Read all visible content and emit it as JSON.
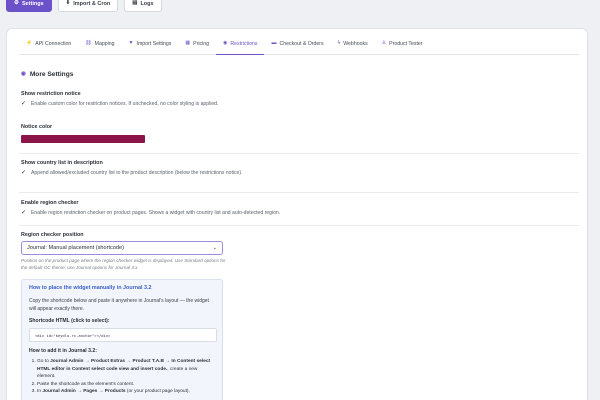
{
  "top_nav": [
    {
      "label": "Settings",
      "icon": "gear-icon",
      "glyph": "⚙",
      "active": true
    },
    {
      "label": "Import & Cron",
      "icon": "import-icon",
      "glyph": "⬇",
      "active": false
    },
    {
      "label": "Logs",
      "icon": "logs-icon",
      "glyph": "▤",
      "active": false
    }
  ],
  "tabs": [
    {
      "label": "API Connection",
      "icon": "plug-icon",
      "glyph": "⚡",
      "active": false
    },
    {
      "label": "Mapping",
      "icon": "mapping-icon",
      "glyph": "⛓",
      "active": false
    },
    {
      "label": "Import Settings",
      "icon": "filter-icon",
      "glyph": "▼",
      "active": false
    },
    {
      "label": "Pricing",
      "icon": "pricing-icon",
      "glyph": "▦",
      "active": false
    },
    {
      "label": "Restrictions",
      "icon": "eye-icon",
      "glyph": "◉",
      "active": true
    },
    {
      "label": "Checkout & Orders",
      "icon": "cart-icon",
      "glyph": "▬",
      "active": false
    },
    {
      "label": "Webhooks",
      "icon": "webhook-icon",
      "glyph": "ϟ",
      "active": false
    },
    {
      "label": "Product Tester",
      "icon": "flask-icon",
      "glyph": "♙",
      "active": false
    }
  ],
  "section": {
    "title": "More Settings",
    "icon": "eye-icon",
    "glyph": "◉"
  },
  "fields": {
    "show_notice": {
      "label": "Show restriction notice",
      "checkbox": "Enable custom color for restriction notices. If unchecked, no color styling is applied.",
      "checked": true
    },
    "notice_color": {
      "label": "Notice color",
      "value": "#8b1449"
    },
    "country_list": {
      "label": "Show country list in description",
      "checkbox": "Append allowed/excluded country list to the product description (below the restrictions notice).",
      "checked": true
    },
    "region_checker": {
      "label": "Enable region checker",
      "checkbox": "Enable region restriction checker on product pages. Shows a widget with country list and auto-detected region.",
      "checked": true
    },
    "region_position": {
      "label": "Region checker position",
      "selected": "Journal: Manual placement (shortcode)",
      "help": "Position on the product page where the region checker widget is displayed. Use Standard options for the default OC theme; use Journal options for Journal 3.x."
    }
  },
  "infobox": {
    "title": "How to place the widget manually in Journal 3.2",
    "intro": "Copy the shortcode below and paste it anywhere in Journal's layout — the widget will appear exactly there.",
    "shortcode_label": "Shortcode HTML (click to select):",
    "shortcode": "<div id=\"keydlo-rc-anchor\"></div>",
    "howto_label": "How to add it in Journal 3.2:",
    "steps": [
      {
        "pre": "Go to ",
        "bold": "Journal Admin → Product Extras → Product T.A.B → In Content select HTML editor in Content select code view and insert code.",
        "post": ", create a new element."
      },
      {
        "pre": "Paste the shortcode as the element's content.",
        "bold": "",
        "post": ""
      },
      {
        "pre": "In ",
        "bold": "Journal Admin → Pages → Products",
        "post": " (or your product page layout),"
      }
    ]
  },
  "colors": {
    "accent": "#6b52c8",
    "notice": "#8b1449"
  }
}
